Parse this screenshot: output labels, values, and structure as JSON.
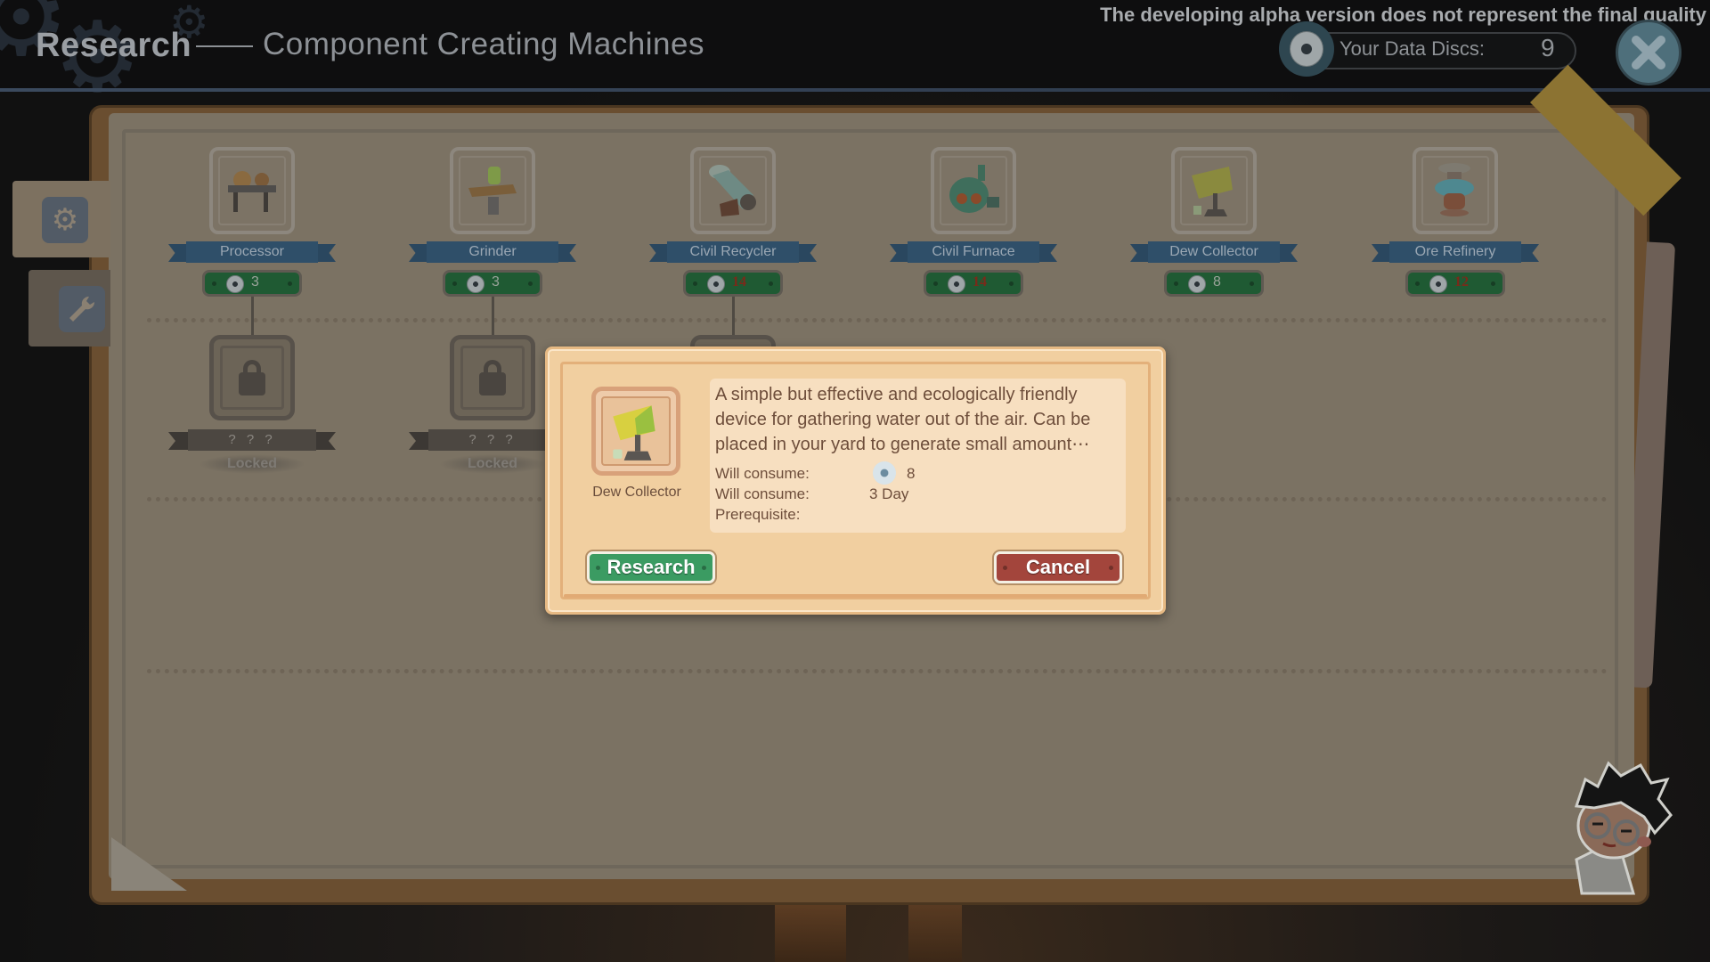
{
  "header": {
    "title": "Research",
    "subtitle": "Component Creating Machines",
    "alpha_notice": "The developing alpha version does not represent the final quality",
    "data_discs_label": "Your Data Discs:",
    "data_discs_value": "9",
    "close_icon": "close-icon"
  },
  "side_tabs": [
    {
      "icon": "gear-icon",
      "active": true
    },
    {
      "icon": "wrench-icon",
      "active": false
    }
  ],
  "machines": [
    {
      "name": "Processor",
      "cost": "3",
      "affordable": true
    },
    {
      "name": "Grinder",
      "cost": "3",
      "affordable": true
    },
    {
      "name": "Civil Recycler",
      "cost": "14",
      "affordable": false
    },
    {
      "name": "Civil Furnace",
      "cost": "14",
      "affordable": false
    },
    {
      "name": "Dew Collector",
      "cost": "8",
      "affordable": true
    },
    {
      "name": "Ore Refinery",
      "cost": "12",
      "affordable": false
    }
  ],
  "locked_nodes": [
    {
      "name": "? ? ?",
      "status": "Locked"
    },
    {
      "name": "? ? ?",
      "status": "Locked"
    }
  ],
  "dialog": {
    "item_name": "Dew Collector",
    "description": "A simple but effective and ecologically friendly device for gathering water out of the air. Can be placed in your yard to generate small amount⋯",
    "rows": [
      {
        "label": "Will consume:",
        "value": "8",
        "icon": "data-disc-icon"
      },
      {
        "label": "Will consume:",
        "value": "3 Day"
      },
      {
        "label": "Prerequisite:",
        "value": ""
      }
    ],
    "research_button": "Research",
    "cancel_button": "Cancel"
  },
  "colors": {
    "research_button": "#3b9b62",
    "cancel_button": "#a3453c",
    "banner": "#2f4f69",
    "cost_badge": "#1f5a33",
    "insufficient_cost": "#7a2a1a"
  }
}
